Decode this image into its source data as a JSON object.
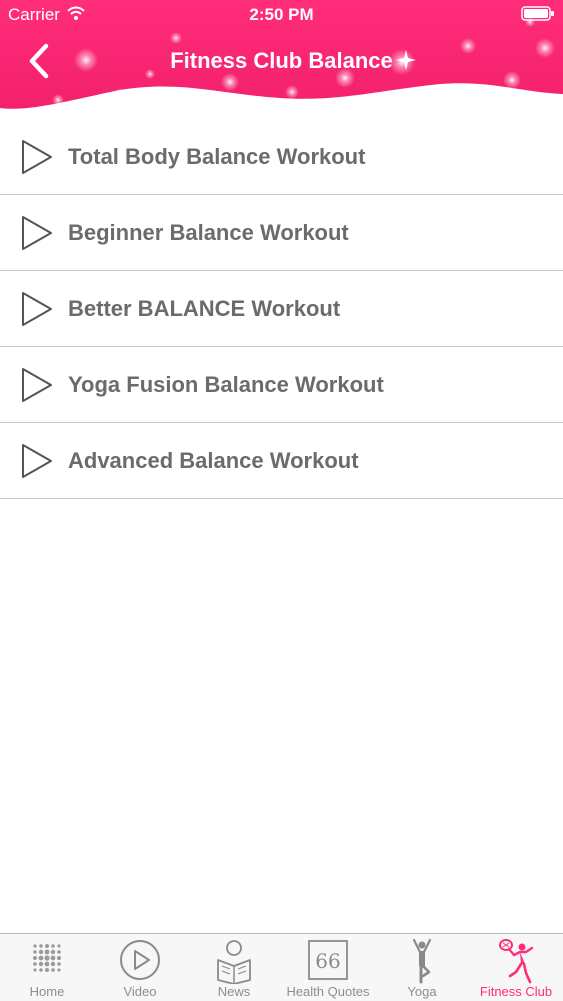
{
  "status_bar": {
    "carrier": "Carrier",
    "time": "2:50 PM"
  },
  "nav": {
    "title": "Fitness Club Balance",
    "back_icon": "chevron-left-icon"
  },
  "workouts": [
    {
      "label": "Total Body Balance Workout",
      "icon": "play-icon"
    },
    {
      "label": "Beginner Balance Workout",
      "icon": "play-icon"
    },
    {
      "label": "Better BALANCE Workout",
      "icon": "play-icon"
    },
    {
      "label": "Yoga Fusion Balance Workout",
      "icon": "play-icon"
    },
    {
      "label": "Advanced Balance Workout",
      "icon": "play-icon"
    }
  ],
  "tabs": [
    {
      "label": "Home",
      "icon": "dots-grid-icon",
      "active": false
    },
    {
      "label": "Video",
      "icon": "play-circle-icon",
      "active": false
    },
    {
      "label": "News",
      "icon": "newspaper-reader-icon",
      "active": false
    },
    {
      "label": "Health Quotes",
      "icon": "quote-66-icon",
      "active": false
    },
    {
      "label": "Yoga",
      "icon": "yoga-pose-icon",
      "active": false
    },
    {
      "label": "Fitness Club",
      "icon": "tennis-player-icon",
      "active": true
    }
  ],
  "colors": {
    "header_pink": "#ff2d7a",
    "active_tab": "#ff2d7a",
    "inactive_tab": "#8e8e8e",
    "row_text": "#6b6b6b",
    "separator": "#c9c9cd"
  }
}
